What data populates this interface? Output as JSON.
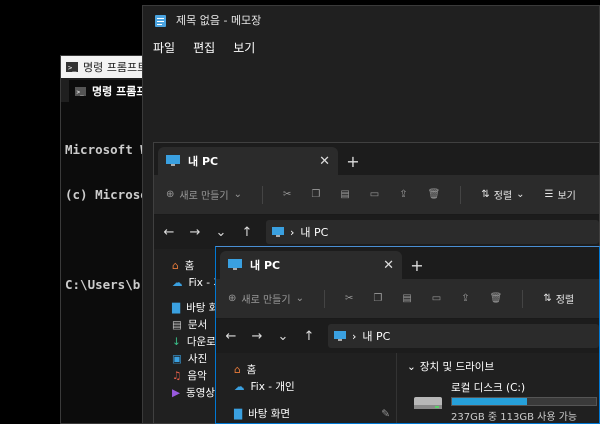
{
  "cmd": {
    "title": "명령 프롬프트",
    "tab_label": "명령 프롬프트",
    "lines": [
      "Microsoft Windows",
      "(c) Microsoft",
      "",
      "C:\\Users\\b"
    ]
  },
  "notepad": {
    "title": "제목 없음 - 메모장",
    "menu": [
      "파일",
      "편집",
      "보기"
    ]
  },
  "explorer_back": {
    "tab": "내 PC",
    "toolbar": {
      "new": "새로 만들기",
      "sort": "정렬",
      "view": "보기"
    },
    "path": "내 PC",
    "sidebar": [
      "홈",
      "Fix - 개인",
      "바탕 화면",
      "문서",
      "다운로드",
      "사진",
      "음악",
      "동영상"
    ]
  },
  "explorer_front": {
    "tab": "내 PC",
    "toolbar": {
      "new": "새로 만들기",
      "sort": "정렬"
    },
    "path": "내 PC",
    "sidebar": [
      "홈",
      "Fix - 개인",
      "바탕 화면"
    ],
    "section": "장치 및 드라이브",
    "drive": {
      "name": "로컬 디스크 (C:)",
      "usage": "237GB 중 113GB 사용 가능",
      "used_fraction": 0.52
    }
  },
  "colors": {
    "accent": "#0078d4",
    "drive_fill": "#26a0da"
  }
}
